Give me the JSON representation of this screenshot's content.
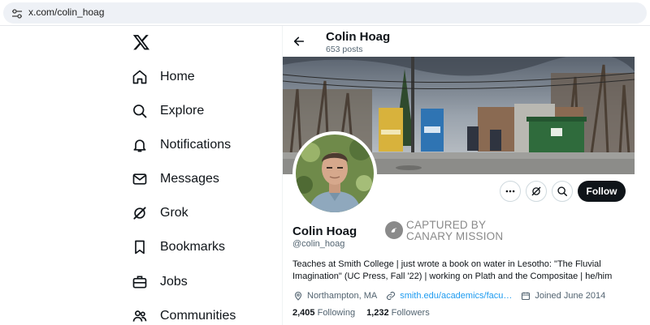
{
  "browser": {
    "url": "x.com/colin_hoag"
  },
  "nav": {
    "items": [
      {
        "label": "Home",
        "icon": "home-icon"
      },
      {
        "label": "Explore",
        "icon": "search-icon"
      },
      {
        "label": "Notifications",
        "icon": "bell-icon"
      },
      {
        "label": "Messages",
        "icon": "envelope-icon"
      },
      {
        "label": "Grok",
        "icon": "grok-icon"
      },
      {
        "label": "Bookmarks",
        "icon": "bookmark-icon"
      },
      {
        "label": "Jobs",
        "icon": "briefcase-icon"
      },
      {
        "label": "Communities",
        "icon": "people-icon"
      }
    ]
  },
  "header": {
    "name": "Colin Hoag",
    "posts": "653 posts"
  },
  "profile": {
    "name": "Colin Hoag",
    "handle": "@colin_hoag",
    "follow_label": "Follow",
    "bio": "Teaches at Smith College | just wrote a book on water in Lesotho: \"The Fluvial Imagination\" (UC Press, Fall '22) | working on Plath and the Compositae | he/him",
    "location": "Northampton, MA",
    "website": "smith.edu/academics/facu…",
    "joined": "Joined June 2014",
    "following_count": "2,405",
    "following_label": "Following",
    "followers_count": "1,232",
    "followers_label": "Followers"
  },
  "stamp": {
    "line1": "CAPTURED BY",
    "line2": "CANARY MISSION"
  },
  "colors": {
    "follow_bg": "#0f1419",
    "link": "#1d9bf0",
    "muted": "#536471"
  }
}
